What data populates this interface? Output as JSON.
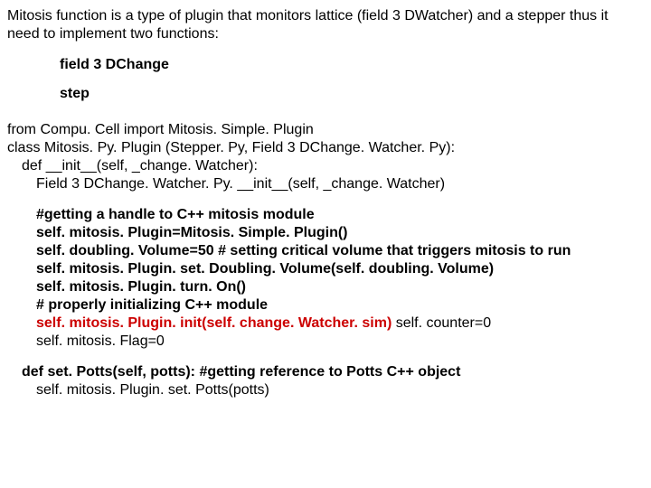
{
  "intro": "Mitosis function is a type of plugin that monitors lattice (field 3 DWatcher) and a stepper thus it need to implement two functions:",
  "fn1": "field 3 DChange",
  "fn2": "step",
  "l1": "from Compu. Cell import Mitosis. Simple. Plugin",
  "l2": "class Mitosis. Py. Plugin (Stepper. Py, Field 3 DChange. Watcher. Py):",
  "l3": "def __init__(self, _change. Watcher):",
  "l4": "Field 3 DChange. Watcher. Py. __init__(self, _change. Watcher)",
  "l5": "#getting a handle to C++ mitosis module",
  "l6": "self. mitosis. Plugin=Mitosis. Simple. Plugin()",
  "l7": "self. doubling. Volume=50 # setting critical volume that triggers mitosis to run",
  "l8": "self. mitosis. Plugin. set. Doubling. Volume(self. doubling. Volume)",
  "l9": "self. mitosis. Plugin. turn. On()",
  "l10": "# properly initializing C++ module",
  "l11a": "self. mitosis. Plugin. init(self. change. Watcher. sim)",
  "l11b": " self. counter=0",
  "l12": "self. mitosis. Flag=0",
  "l13": "def set. Potts(self, potts): #getting reference to Potts C++ object",
  "l14": "self. mitosis. Plugin. set. Potts(potts)"
}
